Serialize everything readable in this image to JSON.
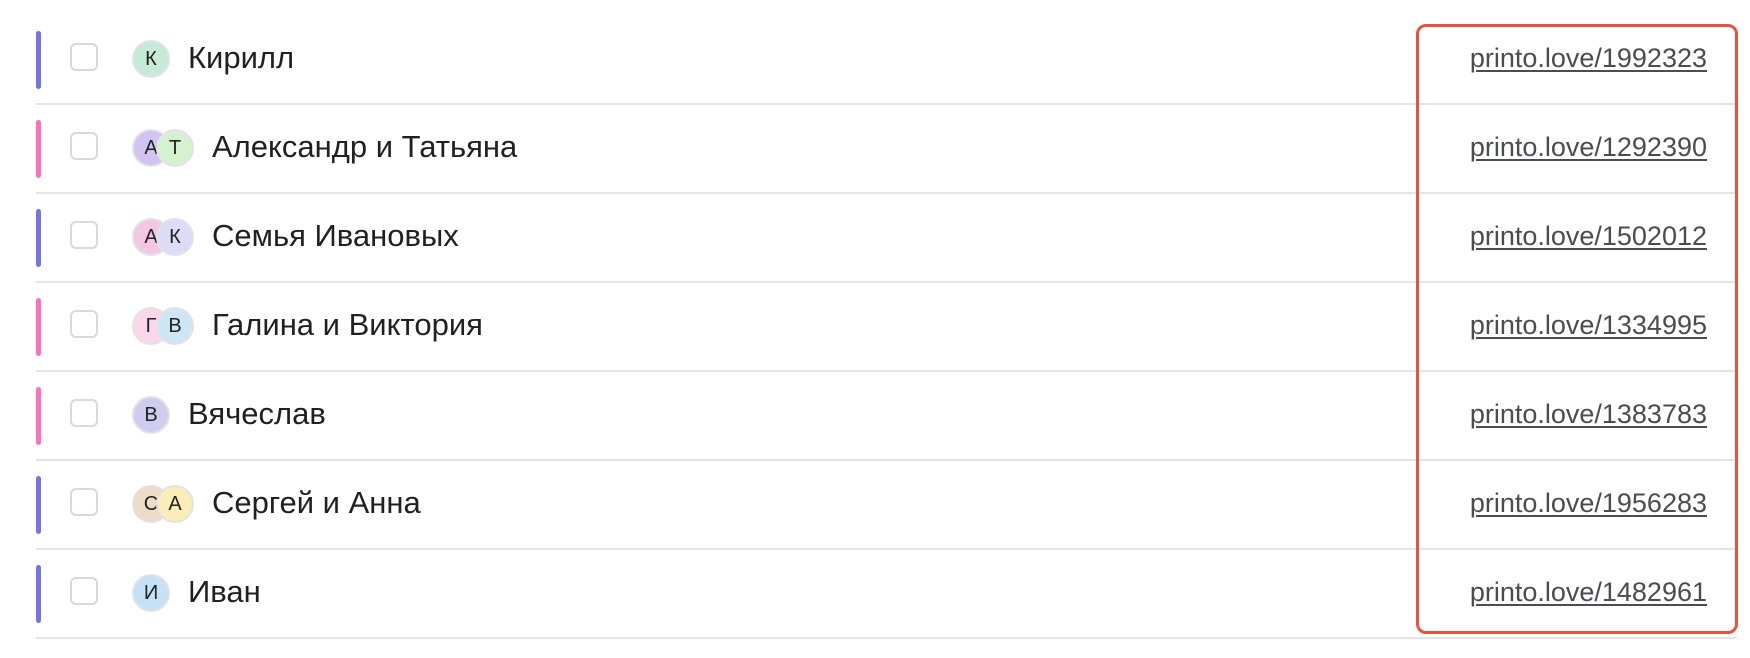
{
  "colors": {
    "accent_purple": "#7373ea",
    "accent_pink": "#ff6fbf",
    "highlight_border": "#e5533d"
  },
  "rows": [
    {
      "accent": "#7373ea",
      "avatars": [
        {
          "initial": "К",
          "bg": "#c5ead6"
        }
      ],
      "name": "Кирилл",
      "link": "printo.love/1992323"
    },
    {
      "accent": "#ff6fbf",
      "avatars": [
        {
          "initial": "А",
          "bg": "#d3c3f3"
        },
        {
          "initial": "Т",
          "bg": "#d4f2cd"
        }
      ],
      "name": "Александр и Татьяна",
      "link": "printo.love/1292390"
    },
    {
      "accent": "#7373ea",
      "avatars": [
        {
          "initial": "А",
          "bg": "#f4c6e2"
        },
        {
          "initial": "К",
          "bg": "#dcdcf6"
        }
      ],
      "name": "Семья Ивановых",
      "link": "printo.love/1502012"
    },
    {
      "accent": "#ff6fbf",
      "avatars": [
        {
          "initial": "Г",
          "bg": "#fbd7ec"
        },
        {
          "initial": "В",
          "bg": "#cce6f5"
        }
      ],
      "name": "Галина и Виктория",
      "link": "printo.love/1334995"
    },
    {
      "accent": "#ff6fbf",
      "avatars": [
        {
          "initial": "В",
          "bg": "#cfccef"
        }
      ],
      "name": "Вячеслав",
      "link": "printo.love/1383783"
    },
    {
      "accent": "#7373ea",
      "avatars": [
        {
          "initial": "С",
          "bg": "#ecdcc8"
        },
        {
          "initial": "А",
          "bg": "#fbedb8"
        }
      ],
      "name": "Сергей и Анна",
      "link": "printo.love/1956283"
    },
    {
      "accent": "#7373ea",
      "avatars": [
        {
          "initial": "И",
          "bg": "#c4e1f6"
        }
      ],
      "name": "Иван",
      "link": "printo.love/1482961"
    }
  ]
}
